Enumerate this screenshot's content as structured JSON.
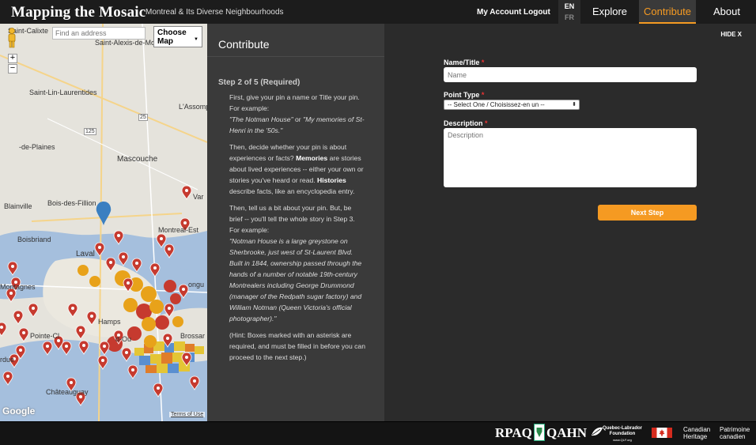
{
  "header": {
    "site_title": "Mapping the Mosaic",
    "subtitle": "Montreal & Its Diverse Neighbourhoods",
    "my_account": "My Account",
    "logout": "Logout",
    "languages": [
      "EN",
      "FR"
    ],
    "nav": {
      "explore": "Explore",
      "contribute": "Contribute",
      "about": "About"
    }
  },
  "colors": {
    "accent": "#f59a22",
    "pin_red": "#c63a2f",
    "pin_orange": "#e8a21a",
    "pin_blue": "#3a7fc1"
  },
  "map": {
    "address_placeholder": "Find an address",
    "choose_map": "Choose Map",
    "zoom_in": "+",
    "zoom_out": "−",
    "google": "Google",
    "terms": "Terms of Use",
    "labels": {
      "saint_calixte": "Saint-Calixte",
      "saint_alexis": "Saint-Alexis-de-Mo",
      "saint_lin": "Saint-Lin-Laurentides",
      "lassomp": "L'Assomp",
      "des_plaines": "-de-Plaines",
      "mascouche": "Mascouche",
      "blainville": "Blainville",
      "bois_des_filion": "Bois-des-Fillion",
      "var": "Var",
      "montreal_est": "Montreal-Est",
      "boisbriand": "Boisbriand",
      "laval": "Laval",
      "montagnes": "Montagnes",
      "longu": "ongu",
      "hamps": "Hamps",
      "brossar": "Brossar",
      "pointe_cl": "Pointe-Cl",
      "ouest": "d-Ou",
      "rdue": "rdue",
      "chateauguay": "Châteauguay",
      "route_25": "25",
      "route_125": "125"
    }
  },
  "contribute": {
    "title": "Contribute",
    "hide": "HIDE X",
    "step": "Step 2 of 5 (Required)",
    "p1": "First, give your pin a name or Title your pin. For example:",
    "p1_example_a": "\"The Notman House\"",
    "p1_or": " or ",
    "p1_example_b": "\"My memories of St-Henri in the '50s.\"",
    "p2_a": "Then, decide whether your pin is about experiences or facts? ",
    "p2_memories": "Memories",
    "p2_b": " are stories about lived experiences -- either your own or stories you've heard or read. ",
    "p2_histories": "Histories",
    "p2_c": " describe facts, like an encyclopedia entry.",
    "p3": "Then, tell us a bit about your pin. But, be brief -- you'll tell the whole story in Step 3. For example:",
    "p3_example": "\"Notman House is a large greystone on Sherbrooke, just west of St-Laurent Blvd. Built in 1844, ownership passed through the hands of a number of notable 19th-century Montrealers including George Drummond (manager of the Redpath sugar factory) and William Notman (Queen Victoria's official photographer).\"",
    "p4": "(Hint: Boxes marked with an asterisk are required, and must be filled in before you can proceed to the next step.)"
  },
  "form": {
    "name_label": "Name/Title",
    "name_placeholder": "Name",
    "type_label": "Point Type",
    "type_selected": "-- Select One / Choisissez-en un --",
    "desc_label": "Description",
    "desc_placeholder": "Description",
    "required_mark": "*",
    "next": "Next Step"
  },
  "footer": {
    "rpaq": "RPAQ",
    "qahn": "QAHN",
    "qlf_line1": "Quebec-Labrador",
    "qlf_line2": "Foundation",
    "qlf_line3": "www.QLF.org",
    "canadian": "Canadian",
    "heritage": "Heritage",
    "patrimoine": "Patrimoine",
    "canadien": "canadien"
  }
}
